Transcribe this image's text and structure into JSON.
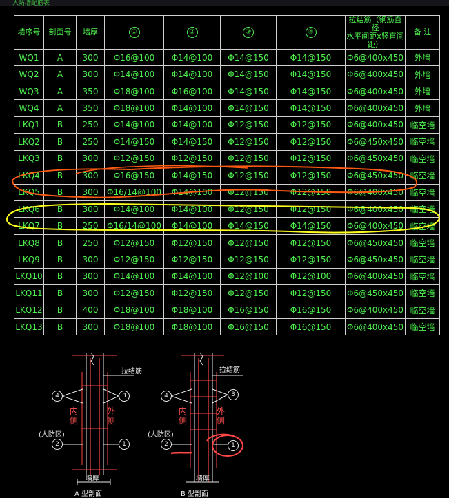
{
  "tab_title": "人防墙配筋表",
  "table": {
    "headers": [
      "墙序号",
      "剖面号",
      "墙厚",
      "①",
      "②",
      "③",
      "④",
      "拉结筋（钢筋直径\n水平间距x竖直间距）",
      "备 注"
    ],
    "rows": [
      [
        "WQ1",
        "A",
        "300",
        "Φ16@100",
        "Φ14@100",
        "Φ14@150",
        "Φ14@150",
        "Φ6@400x450",
        "外墙"
      ],
      [
        "WQ2",
        "A",
        "300",
        "Φ14@100",
        "Φ14@100",
        "Φ14@150",
        "Φ14@150",
        "Φ6@400x450",
        "外墙"
      ],
      [
        "WQ3",
        "A",
        "350",
        "Φ18@100",
        "Φ16@100",
        "Φ14@150",
        "Φ14@150",
        "Φ6@400x450",
        "外墙"
      ],
      [
        "WQ4",
        "A",
        "350",
        "Φ18@100",
        "Φ14@100",
        "Φ14@150",
        "Φ14@150",
        "Φ6@400x450",
        "外墙"
      ],
      [
        "LKQ1",
        "B",
        "250",
        "Φ14@100",
        "Φ14@100",
        "Φ12@150",
        "Φ12@150",
        "Φ6@400x450",
        "临空墙"
      ],
      [
        "LKQ2",
        "B",
        "250",
        "Φ14@150",
        "Φ14@150",
        "Φ12@150",
        "Φ12@150",
        "Φ6@450x450",
        "临空墙"
      ],
      [
        "LKQ3",
        "B",
        "300",
        "Φ12@150",
        "Φ12@150",
        "Φ12@150",
        "Φ12@150",
        "Φ6@450x450",
        "临空墙"
      ],
      [
        "LKQ4",
        "B",
        "300",
        "Φ16@150",
        "Φ14@150",
        "Φ12@150",
        "Φ12@150",
        "Φ6@450x450",
        "临空墙"
      ],
      [
        "LKQ5",
        "B",
        "300",
        "Φ16/14@100",
        "Φ14@100",
        "Φ12@150",
        "Φ12@150",
        "Φ6@400x450",
        "临空墙"
      ],
      [
        "LKQ6",
        "B",
        "300",
        "Φ14@100",
        "Φ14@100",
        "Φ12@150",
        "Φ12@150",
        "Φ6@400x450",
        "临空墙"
      ],
      [
        "LKQ7",
        "B",
        "250",
        "Φ16/14@100",
        "Φ14@100",
        "Φ14@150",
        "Φ14@150",
        "Φ6@400x450",
        "临空墙"
      ],
      [
        "LKQ8",
        "B",
        "250",
        "Φ12@150",
        "Φ12@150",
        "Φ12@150",
        "Φ12@150",
        "Φ6@450x450",
        "临空墙"
      ],
      [
        "LKQ9",
        "B",
        "300",
        "Φ12@150",
        "Φ12@150",
        "Φ12@150",
        "Φ12@150",
        "Φ6@450x450",
        "临空墙"
      ],
      [
        "LKQ10",
        "B",
        "300",
        "Φ14@100",
        "Φ14@100",
        "Φ12@100",
        "Φ12@100",
        "Φ6@400x450",
        "临空墙"
      ],
      [
        "LKQ11",
        "B",
        "300",
        "Φ12@150",
        "Φ12@150",
        "Φ12@150",
        "Φ12@150",
        "Φ6@450x450",
        "临空墙"
      ],
      [
        "LKQ12",
        "B",
        "400",
        "Φ18@100",
        "Φ18@100",
        "Φ16@150",
        "Φ16@150",
        "Φ6@400x450",
        "临空墙"
      ],
      [
        "LKQ13",
        "B",
        "300",
        "Φ18@100",
        "Φ18@100",
        "Φ16@150",
        "Φ16@150",
        "Φ6@400x450",
        "临空墙"
      ]
    ]
  },
  "colors": {
    "text": "#4ef24e",
    "grid": "#cfcfcf",
    "orange_markup": "#ff5a14",
    "yellow_markup": "#ffff1e",
    "section_red": "#ff4646"
  },
  "sections": {
    "a": {
      "tie_label": "拉结筋",
      "inner": "内侧",
      "outer": "外侧",
      "civil": "(人防区)",
      "thickness": "墙厚",
      "title": "A 型剖面",
      "bubbles": [
        "4",
        "3",
        "2",
        "1"
      ]
    },
    "b": {
      "tie_label": "拉结筋",
      "inner": "内侧",
      "outer": "外侧",
      "civil": "(人防区)",
      "thickness": "墙厚",
      "title": "B 型剖面",
      "bubbles": [
        "4",
        "3",
        "2",
        "1"
      ]
    }
  }
}
